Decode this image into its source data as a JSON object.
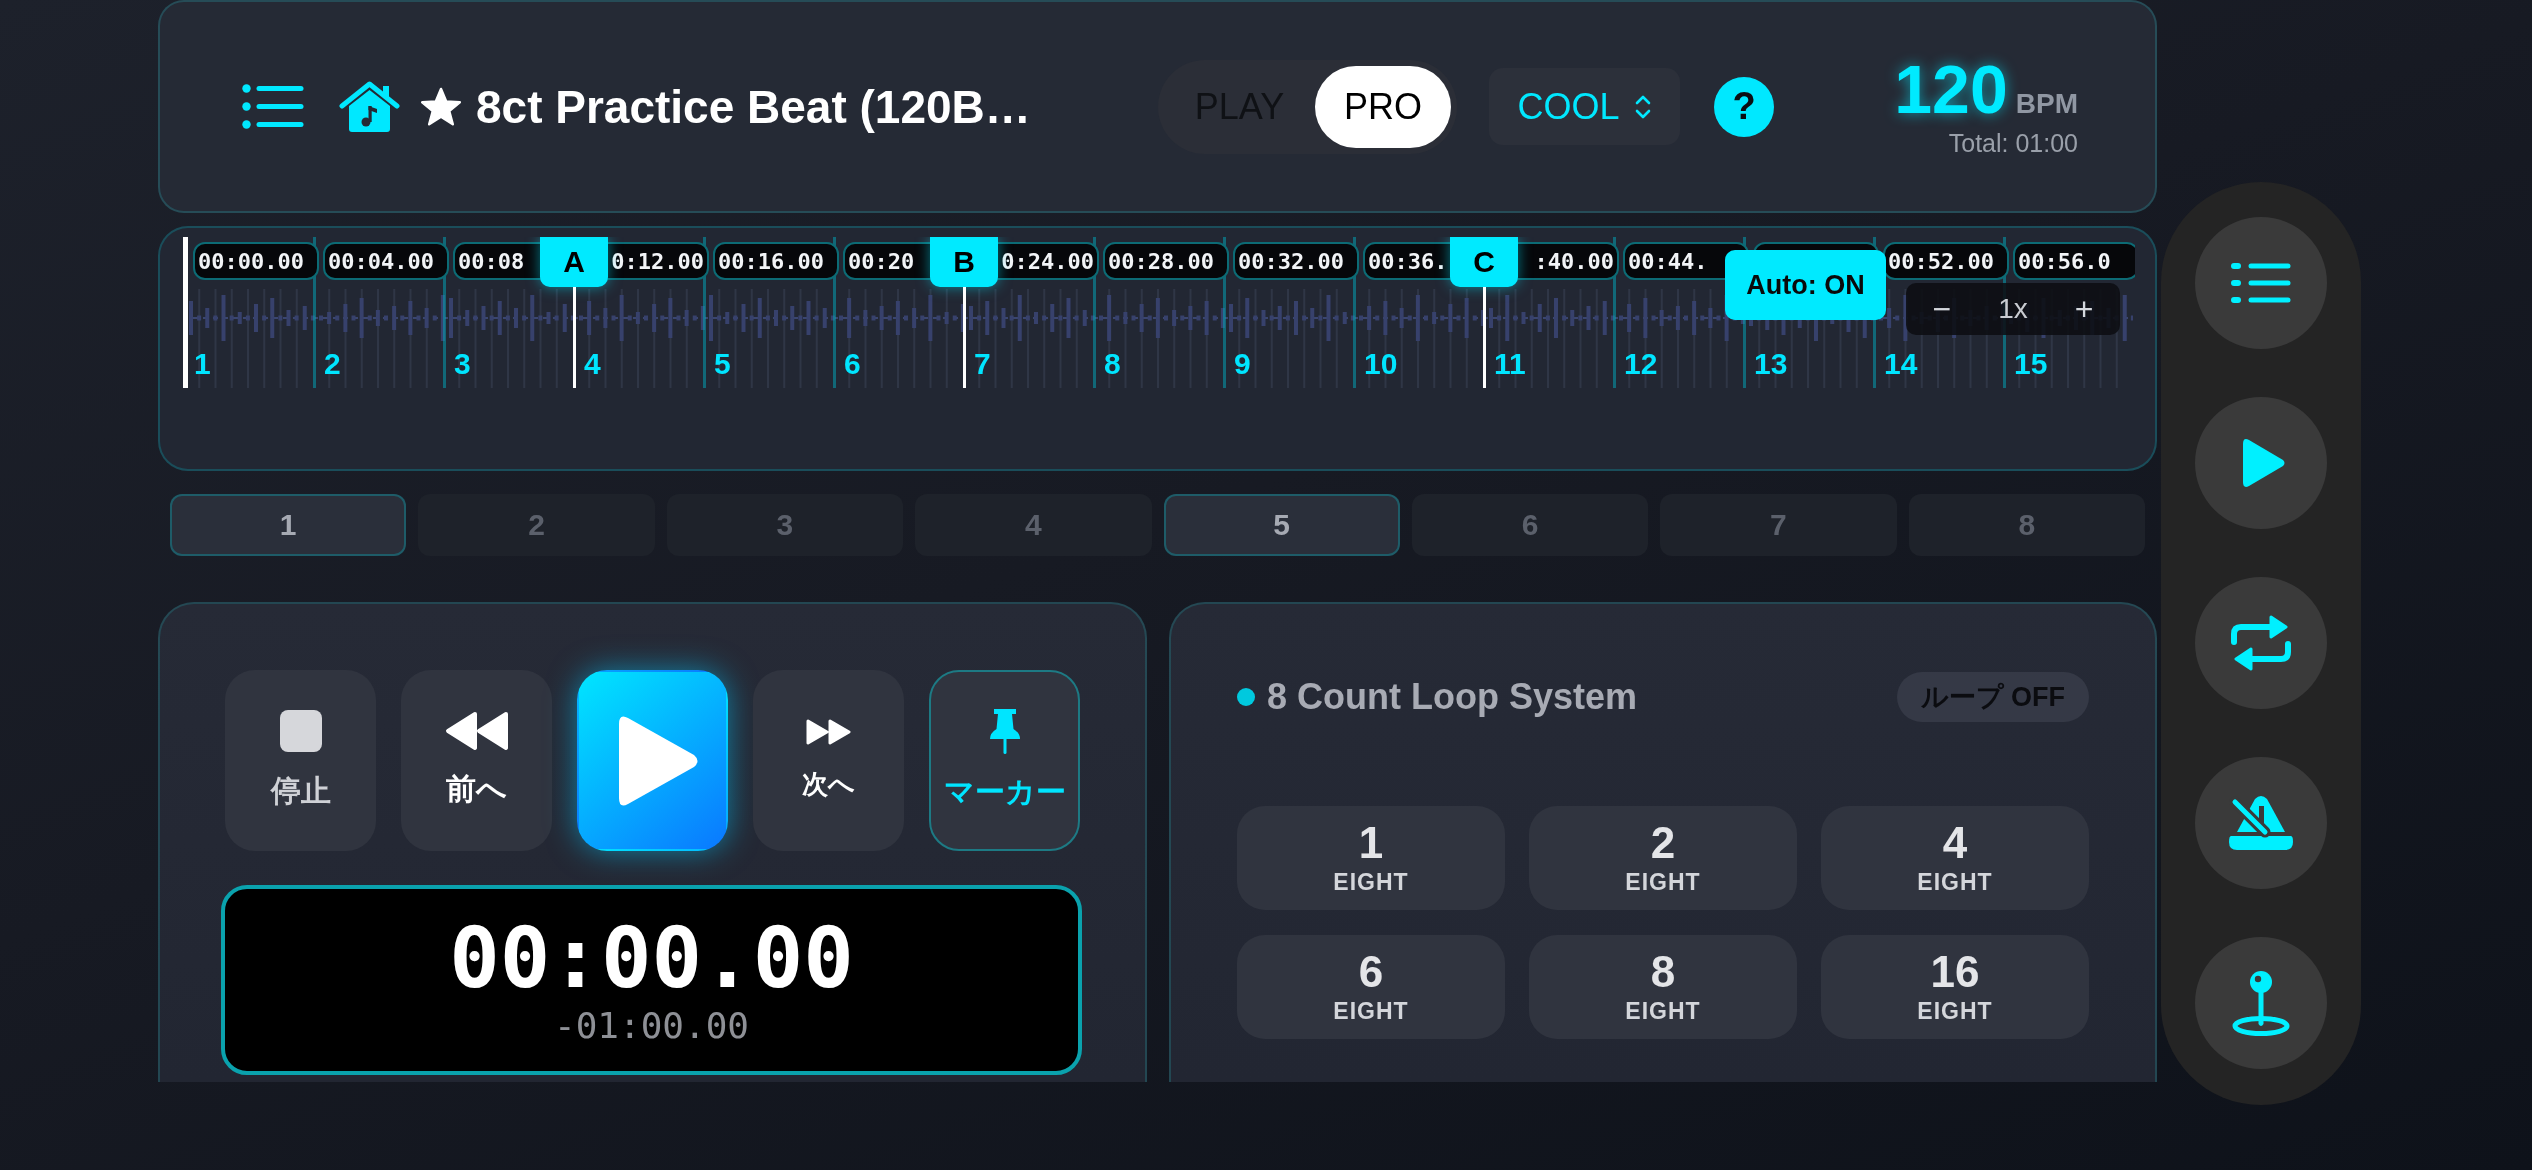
{
  "header": {
    "title": "8ct Practice Beat (120B…",
    "favorite": true,
    "mode_tabs": [
      {
        "label": "PLAY",
        "selected": false
      },
      {
        "label": "PRO",
        "selected": true
      }
    ],
    "theme": "COOL",
    "help": "?",
    "bpm": {
      "value": "120",
      "unit": "BPM",
      "total": "Total: 01:00"
    }
  },
  "timeline": {
    "bars": [
      {
        "number": "1",
        "time": "00:00.00"
      },
      {
        "number": "2",
        "time": "00:04.00"
      },
      {
        "number": "3",
        "time": "00:08"
      },
      {
        "number": "4",
        "time": "0:12.00",
        "marker": "A"
      },
      {
        "number": "5",
        "time": "00:16.00"
      },
      {
        "number": "6",
        "time": "00:20"
      },
      {
        "number": "7",
        "time": "0:24.00",
        "marker": "B"
      },
      {
        "number": "8",
        "time": "00:28.00"
      },
      {
        "number": "9",
        "time": "00:32.00"
      },
      {
        "number": "10",
        "time": "00:36."
      },
      {
        "number": "11",
        "time": ":40.00",
        "marker": "C"
      },
      {
        "number": "12",
        "time": "00:44."
      },
      {
        "number": "13"
      },
      {
        "number": "14",
        "time": "00:52.00"
      },
      {
        "number": "15",
        "time": "00:56.0"
      }
    ],
    "auto_button": "Auto: ON",
    "zoom": {
      "minus": "−",
      "level": "1x",
      "plus": "+"
    }
  },
  "sections": [
    {
      "label": "1",
      "selected": true
    },
    {
      "label": "2",
      "selected": false
    },
    {
      "label": "3",
      "selected": false
    },
    {
      "label": "4",
      "selected": false
    },
    {
      "label": "5",
      "selected": true
    },
    {
      "label": "6",
      "selected": false
    },
    {
      "label": "7",
      "selected": false
    },
    {
      "label": "8",
      "selected": false
    }
  ],
  "transport": {
    "buttons": [
      {
        "kind": "stop",
        "label": "停止",
        "active": false
      },
      {
        "kind": "previous",
        "label": "前へ",
        "active": false
      },
      {
        "kind": "play",
        "active": false
      },
      {
        "kind": "next",
        "label": "次へ",
        "active": false
      },
      {
        "kind": "marker",
        "label": "マーカー",
        "active": true
      }
    ],
    "time": "00:00.00",
    "remaining": "-01:00.00"
  },
  "loop_panel": {
    "title": "8 Count Loop System",
    "toggle": "ループ OFF",
    "counts": [
      {
        "value": "1",
        "unit": "EIGHT"
      },
      {
        "value": "2",
        "unit": "EIGHT"
      },
      {
        "value": "4",
        "unit": "EIGHT"
      },
      {
        "value": "6",
        "unit": "EIGHT"
      },
      {
        "value": "8",
        "unit": "EIGHT"
      },
      {
        "value": "16",
        "unit": "EIGHT"
      }
    ]
  }
}
